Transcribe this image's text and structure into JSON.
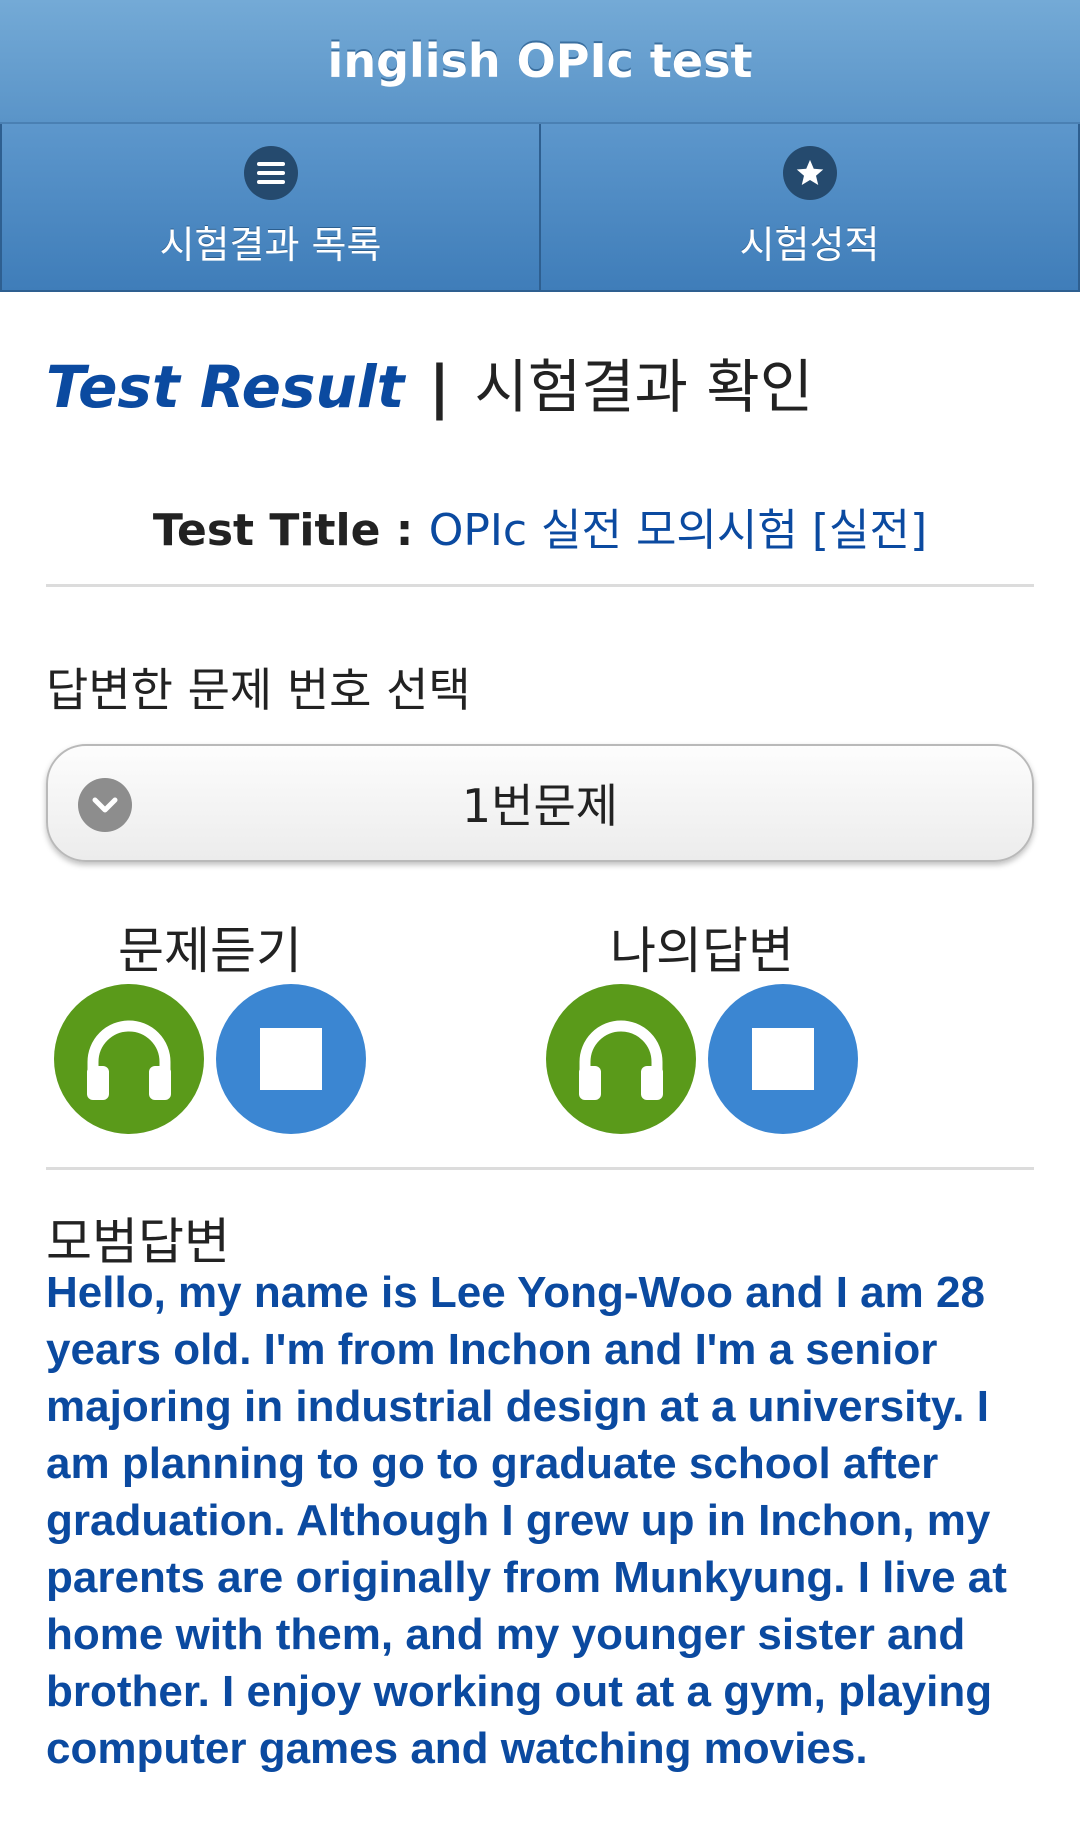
{
  "header": {
    "title": "inglish OPIc test"
  },
  "navbar": {
    "items": [
      {
        "label": "시험결과 목록",
        "icon": "list-icon"
      },
      {
        "label": "시험성적",
        "icon": "star-icon"
      }
    ]
  },
  "page": {
    "title_en": "Test Result",
    "title_sep": "|",
    "title_ko": "시험결과 확인",
    "test_title_label": "Test Title :",
    "test_title_value": "OPIc 실전 모의시험 [실전]"
  },
  "selector": {
    "label": "답변한 문제 번호 선택",
    "selected": "1번문제"
  },
  "audio": {
    "question": {
      "label": "문제듣기"
    },
    "answer": {
      "label": "나의답변"
    }
  },
  "model_answer": {
    "label": "모범답변",
    "text": "Hello, my name is Lee Yong-Woo and I am 28 years old. I'm from Inchon and I'm a senior majoring in industrial design at a university. I am planning to go to graduate school after graduation. Although I grew up in Inchon, my parents are originally from Munkyung. I live at home with them, and my younger sister and brother. I enjoy working out at a gym, playing computer games and watching movies."
  },
  "colors": {
    "header": "#5a94c8",
    "accent_text": "#0b4aa0",
    "play_button": "#5a9a1a",
    "stop_button": "#3b86d2"
  }
}
